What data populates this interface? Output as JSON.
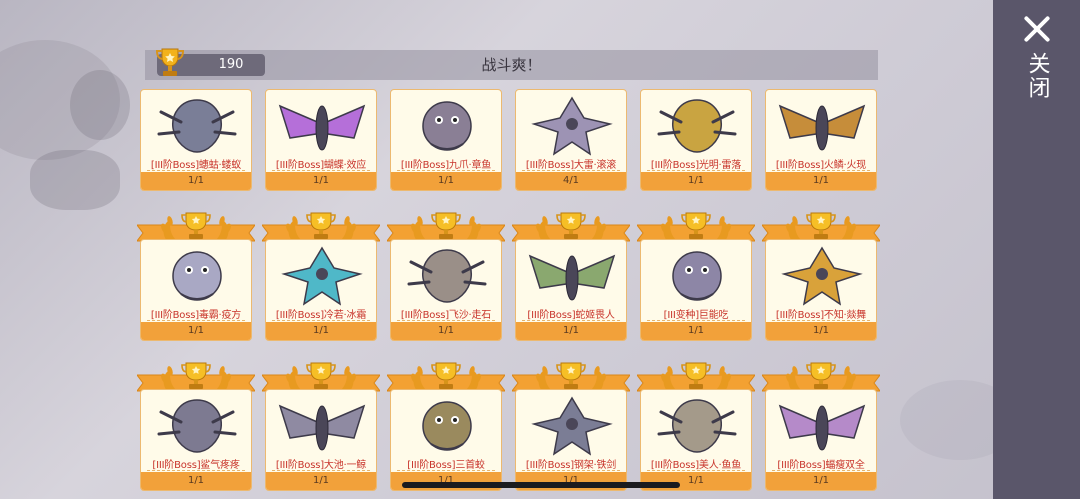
{
  "header": {
    "score": "190",
    "title": "战斗爽！",
    "close_label": "关闭"
  },
  "cards": [
    {
      "name": "[III阶Boss]蟪蛄·蝼蚁",
      "count": "1/1",
      "color": "#7a7e97",
      "trophy": false
    },
    {
      "name": "[III阶Boss]蝴蝶·效应",
      "count": "1/1",
      "color": "#b56fd9",
      "trophy": false
    },
    {
      "name": "[III阶Boss]九爪·章鱼",
      "count": "1/1",
      "color": "#8a7f95",
      "trophy": false
    },
    {
      "name": "[III阶Boss]大雷·滚滚",
      "count": "4/1",
      "color": "#9d93b4",
      "trophy": false
    },
    {
      "name": "[III阶Boss]光明·雷落",
      "count": "1/1",
      "color": "#c9a441",
      "trophy": false
    },
    {
      "name": "[III阶Boss]火鳞·火现",
      "count": "1/1",
      "color": "#c68d3a",
      "trophy": false
    },
    {
      "name": "[III阶Boss]毒霸·疫方",
      "count": "1/1",
      "color": "#a9a8c4",
      "trophy": true
    },
    {
      "name": "[III阶Boss]冷若·冰霜",
      "count": "1/1",
      "color": "#4fb8c8",
      "trophy": true
    },
    {
      "name": "[III阶Boss]飞沙·走石",
      "count": "1/1",
      "color": "#9a8f88",
      "trophy": true
    },
    {
      "name": "[III阶Boss]蛇姬畏人",
      "count": "1/1",
      "color": "#8aa86f",
      "trophy": true
    },
    {
      "name": "[III变种]巨能吃",
      "count": "1/1",
      "color": "#8d86a6",
      "trophy": true
    },
    {
      "name": "[III阶Boss]不知·燚舞",
      "count": "1/1",
      "color": "#d9a23a",
      "trophy": true
    },
    {
      "name": "[III阶Boss]鲨气疼疼",
      "count": "1/1",
      "color": "#7d7a91",
      "trophy": true
    },
    {
      "name": "[III阶Boss]大池·一鲸",
      "count": "1/1",
      "color": "#8f8aa2",
      "trophy": true
    },
    {
      "name": "[III阶Boss]三首蛟",
      "count": "1/1",
      "color": "#9a8a5e",
      "trophy": true
    },
    {
      "name": "[III阶Boss]钢架·铁剑",
      "count": "1/1",
      "color": "#7b7d95",
      "trophy": true
    },
    {
      "name": "[III阶Boss]美人·鱼鱼",
      "count": "1/1",
      "color": "#a49a8a",
      "trophy": true
    },
    {
      "name": "[III阶Boss]蝠瘦双全",
      "count": "1/1",
      "color": "#b58ac9",
      "trophy": true
    }
  ]
}
